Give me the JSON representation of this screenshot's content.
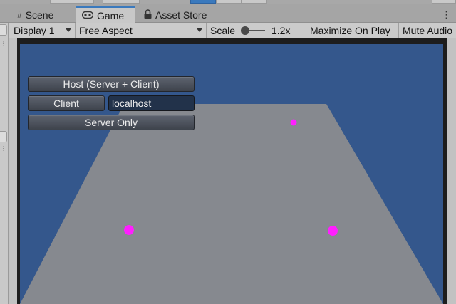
{
  "tabs": [
    {
      "label": "Scene",
      "icon": "grid-icon",
      "active": false
    },
    {
      "label": "Game",
      "icon": "gamepad-icon",
      "active": true
    },
    {
      "label": "Asset Store",
      "icon": "lock-icon",
      "active": false
    }
  ],
  "toolbar": {
    "display": "Display 1",
    "aspect": "Free Aspect",
    "scale_label": "Scale",
    "scale_value": "1.2x",
    "maximize": "Maximize On Play",
    "mute": "Mute Audio"
  },
  "gui": {
    "host_button": "Host (Server + Client)",
    "client_button": "Client",
    "address_value": "localhost",
    "server_only_button": "Server Only"
  },
  "colors": {
    "sky": "#34578c",
    "plane": "#86898f",
    "marker": "#ff1fff",
    "accent": "#3a79bd"
  }
}
